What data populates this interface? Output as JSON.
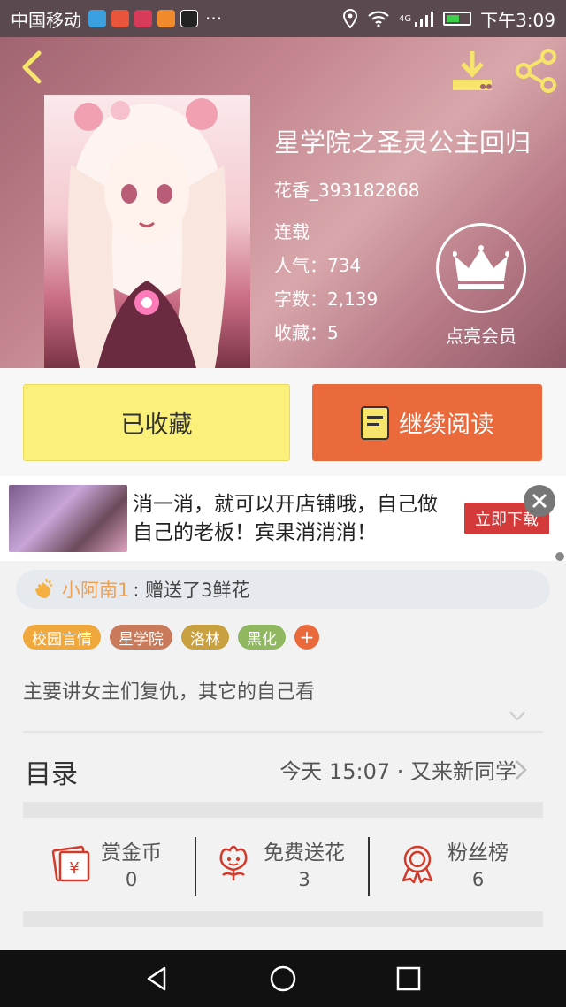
{
  "status_bar": {
    "carrier": "中国移动",
    "more": "···",
    "time": "下午3:09",
    "network": "4G"
  },
  "book": {
    "title": "星学院之圣灵公主回归",
    "author": "花香_393182868",
    "status": "连载",
    "popularity_label": "人气：",
    "popularity": "734",
    "words_label": "字数：",
    "words": "2,139",
    "favorites_label": "收藏：",
    "favorites": "5"
  },
  "vip": {
    "label": "点亮会员"
  },
  "actions": {
    "favorited": "已收藏",
    "continue_reading": "继续阅读"
  },
  "ad": {
    "text": "消一消，就可以开店铺哦，自己做自己的老板！宾果消消消！",
    "button": "立即下载"
  },
  "gift": {
    "user": "小阿南1",
    "text": ": 赠送了3鲜花"
  },
  "tags": [
    {
      "label": "校园言情",
      "color": "#f0a83c"
    },
    {
      "label": "星学院",
      "color": "#c87a5a"
    },
    {
      "label": "洛林",
      "color": "#c8a040"
    },
    {
      "label": "黑化",
      "color": "#8fb860"
    }
  ],
  "tag_add": "+",
  "description": "主要讲女主们复仇，其它的自己看",
  "toc": {
    "label": "目录",
    "update": "今天 15:07 · 又来新同学"
  },
  "stats": [
    {
      "name": "赏金币",
      "value": "0"
    },
    {
      "name": "免费送花",
      "value": "3"
    },
    {
      "name": "粉丝榜",
      "value": "6"
    }
  ],
  "colors": {
    "accent_orange": "#ea6a3b",
    "fav_yellow": "#faf07a",
    "icon_red": "#d43a2a"
  }
}
